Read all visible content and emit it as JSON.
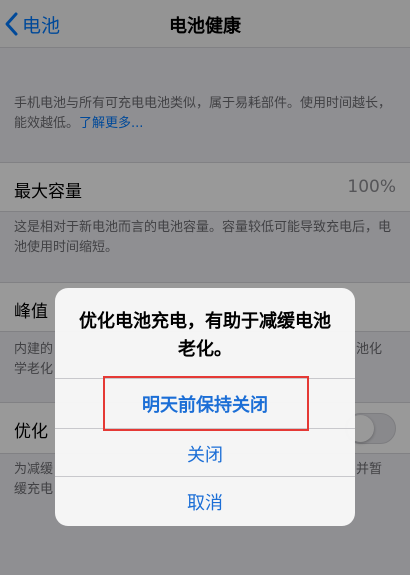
{
  "nav": {
    "back_label": "电池",
    "title": "电池健康"
  },
  "intro": {
    "text": "手机电池与所有可充电电池类似，属于易耗部件。使用时间越长，能效越低。",
    "link": "了解更多..."
  },
  "max_capacity": {
    "label": "最大容量",
    "value": "100%",
    "footer": "这是相对于新电池而言的电池容量。容量较低可能导致充电后，电池使用时间缩短。"
  },
  "peak": {
    "label_partial": "峰值",
    "footer_line1_left": "内建的",
    "footer_line1_right": "池化",
    "footer_line2_left": "学老化"
  },
  "optimize": {
    "label_partial": "优化",
    "toggle_on": false,
    "footer_line1_left": "为减缓",
    "footer_line1_right": "并暂",
    "footer_line2_left": "缓充电"
  },
  "alert": {
    "message": "优化电池充电，有助于减缓电池老化。",
    "actions": [
      {
        "label": "明天前保持关闭"
      },
      {
        "label": "关闭"
      },
      {
        "label": "取消"
      }
    ],
    "highlight_color": "#e53935"
  },
  "colors": {
    "accent": "#007aff",
    "background": "#efeff4",
    "secondary_text": "#6d6d72"
  }
}
